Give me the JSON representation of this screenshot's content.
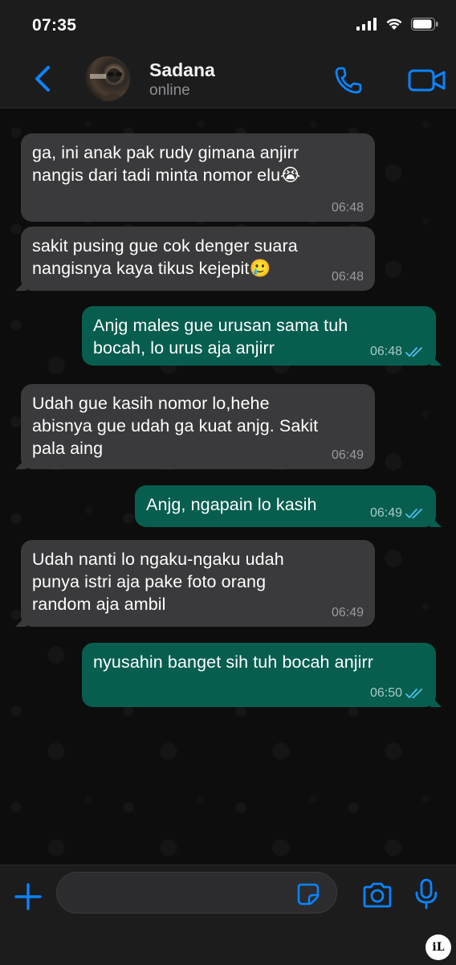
{
  "status_bar": {
    "time": "07:35"
  },
  "header": {
    "contact_name": "Sadana",
    "contact_status": "online"
  },
  "messages": [
    {
      "direction": "in",
      "text": "ga, ini anak pak rudy gimana anjirr\nnangis dari tadi minta nomor elu😭",
      "time": "06:48"
    },
    {
      "direction": "in",
      "text": "sakit pusing gue cok denger suara\nnangisnya kaya tikus kejepit🥲",
      "time": "06:48"
    },
    {
      "direction": "out",
      "text": "Anjg males gue urusan sama tuh\nbocah, lo urus aja anjirr",
      "time": "06:48",
      "status": "read"
    },
    {
      "direction": "in",
      "text": "Udah gue kasih nomor lo,hehe\nabisnya gue udah ga kuat anjg. Sakit\npala aing",
      "time": "06:49"
    },
    {
      "direction": "out",
      "text": "Anjg, ngapain lo kasih",
      "time": "06:49",
      "status": "read"
    },
    {
      "direction": "in",
      "text": "Udah nanti lo ngaku-ngaku udah\npunya istri aja pake foto orang\nrandom aja ambil",
      "time": "06:49"
    },
    {
      "direction": "out",
      "text": "nyusahin banget sih tuh bocah anjirr",
      "time": "06:50",
      "status": "read"
    }
  ],
  "input_bar": {
    "placeholder": ""
  },
  "colors": {
    "accent": "#0a84ff",
    "incoming_bubble": "#3a3a3c",
    "outgoing_bubble": "#075e4f",
    "read_ticks": "#53bdeb"
  },
  "icons": [
    "signal-icon",
    "wifi-icon",
    "battery-icon",
    "back-chevron-icon",
    "phone-icon",
    "video-icon",
    "plus-icon",
    "sticker-icon",
    "camera-icon",
    "microphone-icon",
    "double-check-icon"
  ],
  "watermark": "iL"
}
